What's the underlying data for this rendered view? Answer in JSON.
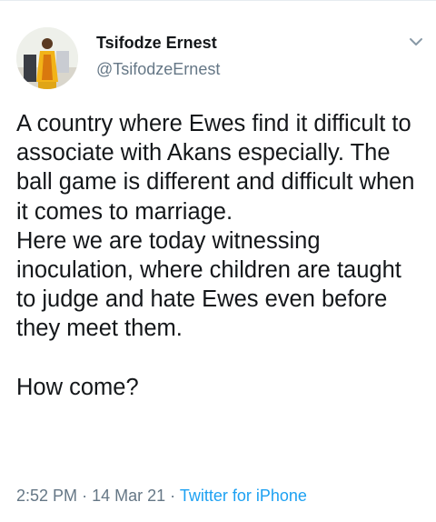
{
  "tweet": {
    "author": {
      "display_name": "Tsifodze Ernest",
      "handle": "@TsifodzeErnest",
      "avatar_icon": "profile-photo"
    },
    "menu_icon": "chevron-down-icon",
    "text": "A country where Ewes find it difficult to associate with Akans especially. The ball game is different and difficult when it comes to marriage.\nHere we are today witnessing inoculation, where children are taught to judge and hate Ewes even before they meet them.\n\nHow come?",
    "time": "2:52 PM",
    "separator": "·",
    "date": "14 Mar 21",
    "source": "Twitter for iPhone"
  },
  "colors": {
    "text": "#14171a",
    "secondary": "#657786",
    "link": "#1da1f2",
    "border": "#e6ecf0"
  }
}
